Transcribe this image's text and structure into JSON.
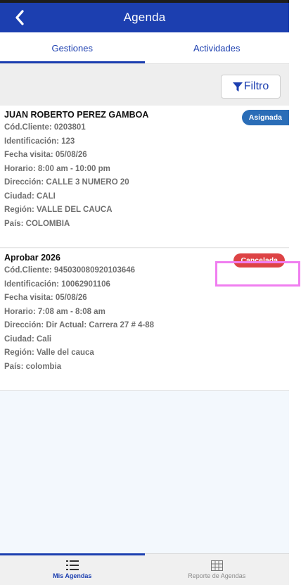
{
  "header": {
    "title": "Agenda",
    "back_icon": "chevron-left-icon"
  },
  "tabs": [
    {
      "label": "Gestiones",
      "active": true
    },
    {
      "label": "Actividades",
      "active": false
    }
  ],
  "filter": {
    "label": "Filtro",
    "icon": "filter-icon"
  },
  "cards": [
    {
      "name": "JUAN ROBERTO PEREZ GAMBOA",
      "status": "Asignada",
      "status_color": "#2a6db7",
      "lines": [
        "Cód.Cliente: 0203801",
        "Identificación: 123",
        "Fecha visita: 05/08/26",
        "Horario: 8:00 am - 10:00 pm",
        "Dirección: CALLE 3 NUMERO 20",
        "Ciudad: CALI",
        "Región: VALLE DEL CAUCA",
        "País: COLOMBIA"
      ]
    },
    {
      "name": "Aprobar 2026",
      "status": "Cancelada",
      "status_color": "#dd4345",
      "lines": [
        "Cód.Cliente: 945030080920103646",
        "Identificación: 10062901106",
        "Fecha visita: 05/08/26",
        "Horario: 7:08 am - 8:08 am",
        "Dirección: Dir Actual: Carrera 27 # 4-88",
        "Ciudad: Cali",
        "Región: Valle del cauca",
        "País: colombia"
      ]
    }
  ],
  "bottom_nav": [
    {
      "label": "Mis Agendas",
      "icon": "list-icon",
      "active": true
    },
    {
      "label": "Reporte de Agendas",
      "icon": "table-icon",
      "active": false
    }
  ],
  "colors": {
    "primary": "#1c3fb0",
    "highlight": "#f07ef0"
  }
}
